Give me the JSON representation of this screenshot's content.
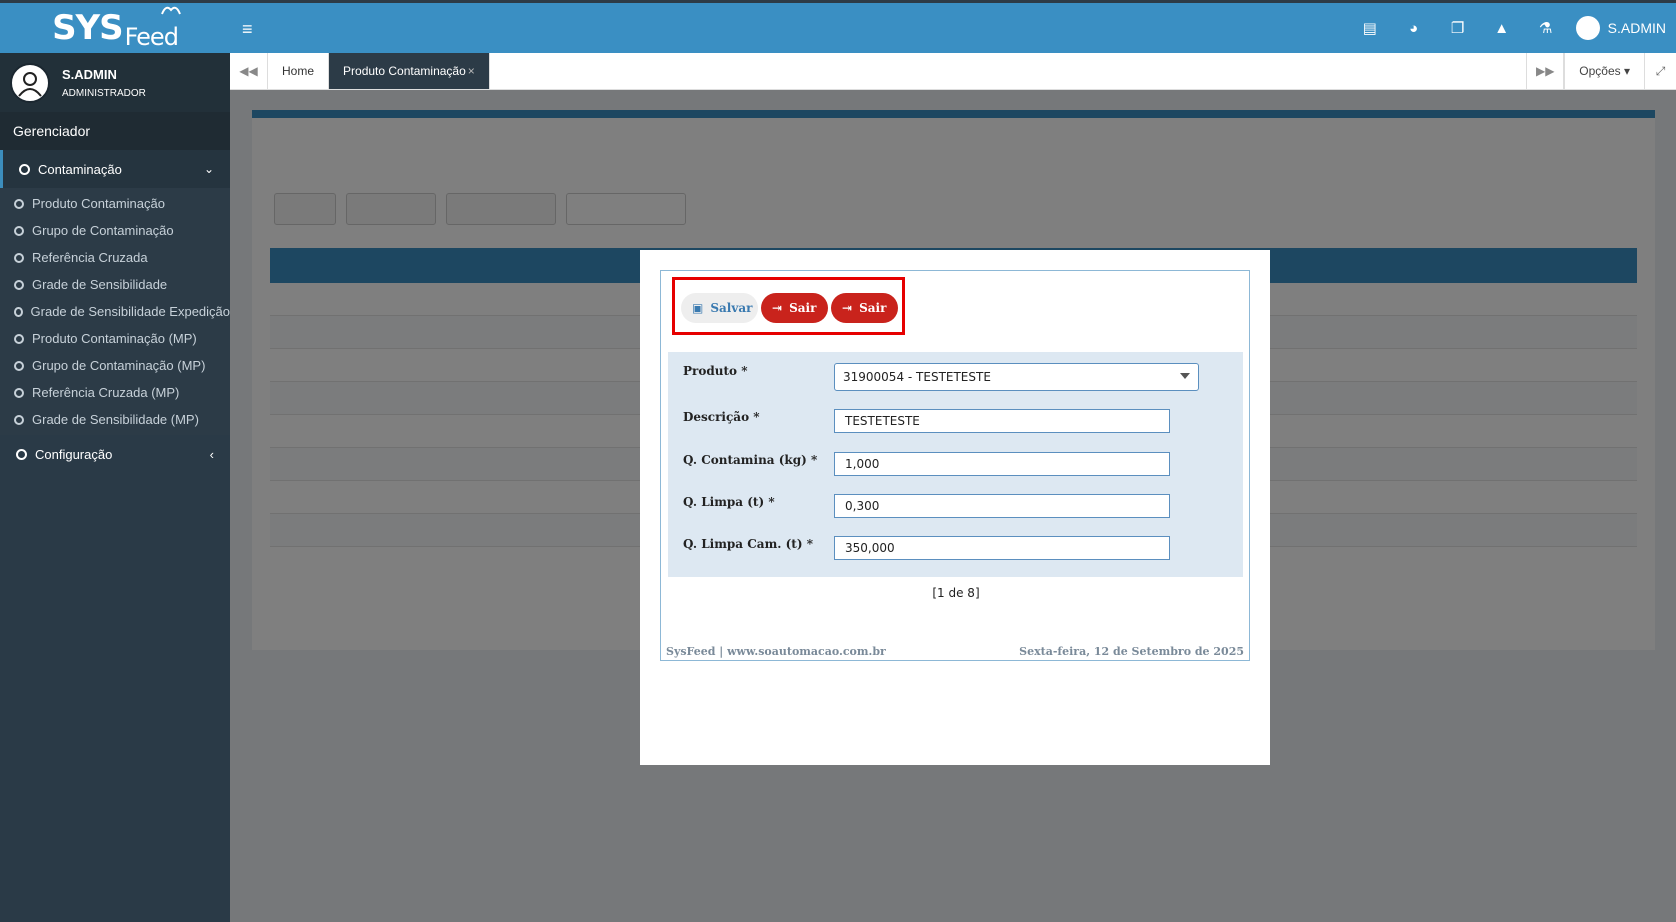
{
  "brand": {
    "logo_main": "SYS",
    "logo_sub": "Feed"
  },
  "user": {
    "name": "S.ADMIN",
    "role": "ADMINISTRADOR"
  },
  "sidebar": {
    "section": "Gerenciador",
    "group": {
      "label": "Contaminação"
    },
    "items": [
      {
        "label": "Produto Contaminação"
      },
      {
        "label": "Grupo de Contaminação"
      },
      {
        "label": "Referência Cruzada"
      },
      {
        "label": "Grade de Sensibilidade"
      },
      {
        "label": "Grade de Sensibilidade Expedição"
      },
      {
        "label": "Produto Contaminação (MP)"
      },
      {
        "label": "Grupo de Contaminação (MP)"
      },
      {
        "label": "Referência Cruzada (MP)"
      },
      {
        "label": "Grade de Sensibilidade (MP)"
      }
    ],
    "config": {
      "label": "Configuração"
    }
  },
  "header": {
    "user": "S.ADMIN"
  },
  "tabs": {
    "items": [
      {
        "label": "Home"
      },
      {
        "label": "Produto Contaminação"
      }
    ],
    "options": "Opções"
  },
  "modal": {
    "toolbar": {
      "salvar": "Salvar",
      "sair1": "Sair",
      "sair2": "Sair"
    },
    "form": {
      "produto_label": "Produto *",
      "produto_value": "31900054 - TESTETESTE",
      "descricao_label": "Descrição *",
      "descricao_value": "TESTETESTE",
      "q_contamina_label": "Q. Contamina (kg) *",
      "q_contamina_value": "1,000",
      "q_limpa_label": "Q. Limpa (t) *",
      "q_limpa_value": "0,300",
      "q_limpa_cam_label": "Q. Limpa Cam. (t) *",
      "q_limpa_cam_value": "350,000"
    },
    "pager": "[1 de 8]",
    "footer_left": "SysFeed | www.soautomacao.com.br",
    "footer_right": "Sexta-feira, 12 de Setembro de 2025"
  },
  "colors": {
    "header": "#3a8fc3",
    "sidebar": "#2a3a47",
    "danger": "#c9231c",
    "highlight": "#e60000"
  }
}
